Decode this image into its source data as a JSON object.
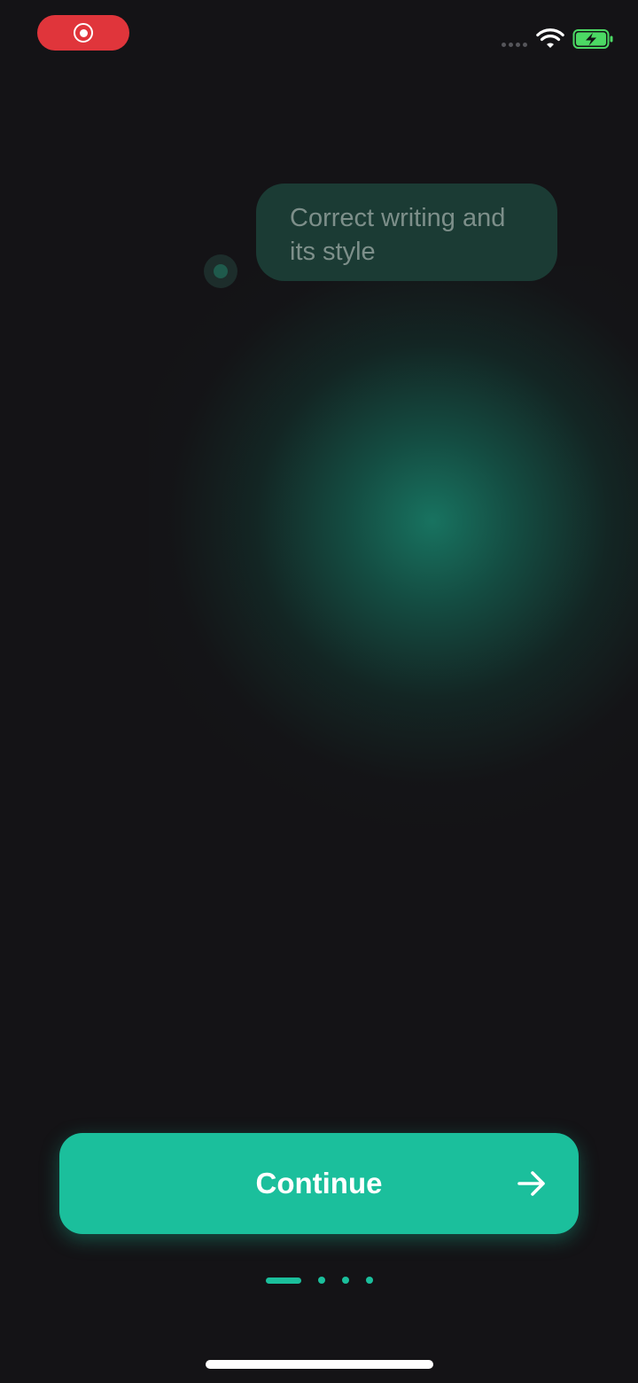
{
  "status_bar": {
    "recording_indicator": "record-icon",
    "signal_icon": "cellular-signal-dots-icon",
    "wifi_icon": "wifi-icon",
    "battery_icon": "battery-charging-icon",
    "battery_color": "#4cd964"
  },
  "onboarding": {
    "bubble_text_line1": "Correct writing and",
    "bubble_text_line2": "its style",
    "faded_title": ""
  },
  "actions": {
    "continue_label": "Continue",
    "continue_icon": "arrow-right-icon",
    "accent_color": "#1bbf9c"
  },
  "pager": {
    "total_pages": 4,
    "current_page": 1
  }
}
